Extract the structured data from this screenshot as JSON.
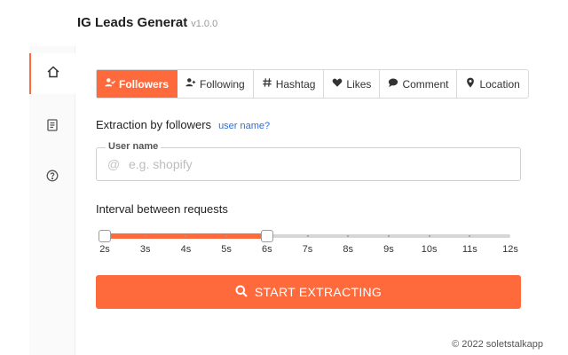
{
  "app": {
    "title": "IG Leads Generat",
    "version": "v1.0.0"
  },
  "sidebar": {
    "items": [
      {
        "name": "home",
        "icon": "home-icon",
        "active": true
      },
      {
        "name": "list",
        "icon": "document-icon",
        "active": false
      },
      {
        "name": "help",
        "icon": "help-icon",
        "active": false
      }
    ]
  },
  "tabs": [
    {
      "label": "Followers",
      "icon": "user-check-icon",
      "active": true
    },
    {
      "label": "Following",
      "icon": "user-plus-icon",
      "active": false
    },
    {
      "label": "Hashtag",
      "icon": "hash-icon",
      "active": false
    },
    {
      "label": "Likes",
      "icon": "heart-icon",
      "active": false
    },
    {
      "label": "Comment",
      "icon": "comment-icon",
      "active": false
    },
    {
      "label": "Location",
      "icon": "location-pin-icon",
      "active": false
    }
  ],
  "extraction": {
    "heading": "Extraction by followers",
    "link": "user name?",
    "field_label": "User name",
    "field_icon": "@",
    "placeholder": "e.g. shopify",
    "value": ""
  },
  "interval": {
    "label": "Interval between requests",
    "ticks": [
      "2s",
      "3s",
      "4s",
      "5s",
      "6s",
      "7s",
      "8s",
      "9s",
      "10s",
      "11s",
      "12s"
    ],
    "min": 2,
    "max": 12,
    "start": 2,
    "end": 6
  },
  "button": {
    "label": "START EXTRACTING"
  },
  "footer": {
    "text": "© 2022 soletstalkapp"
  },
  "colors": {
    "accent": "#ff6a3d",
    "link": "#2f6fd6"
  }
}
